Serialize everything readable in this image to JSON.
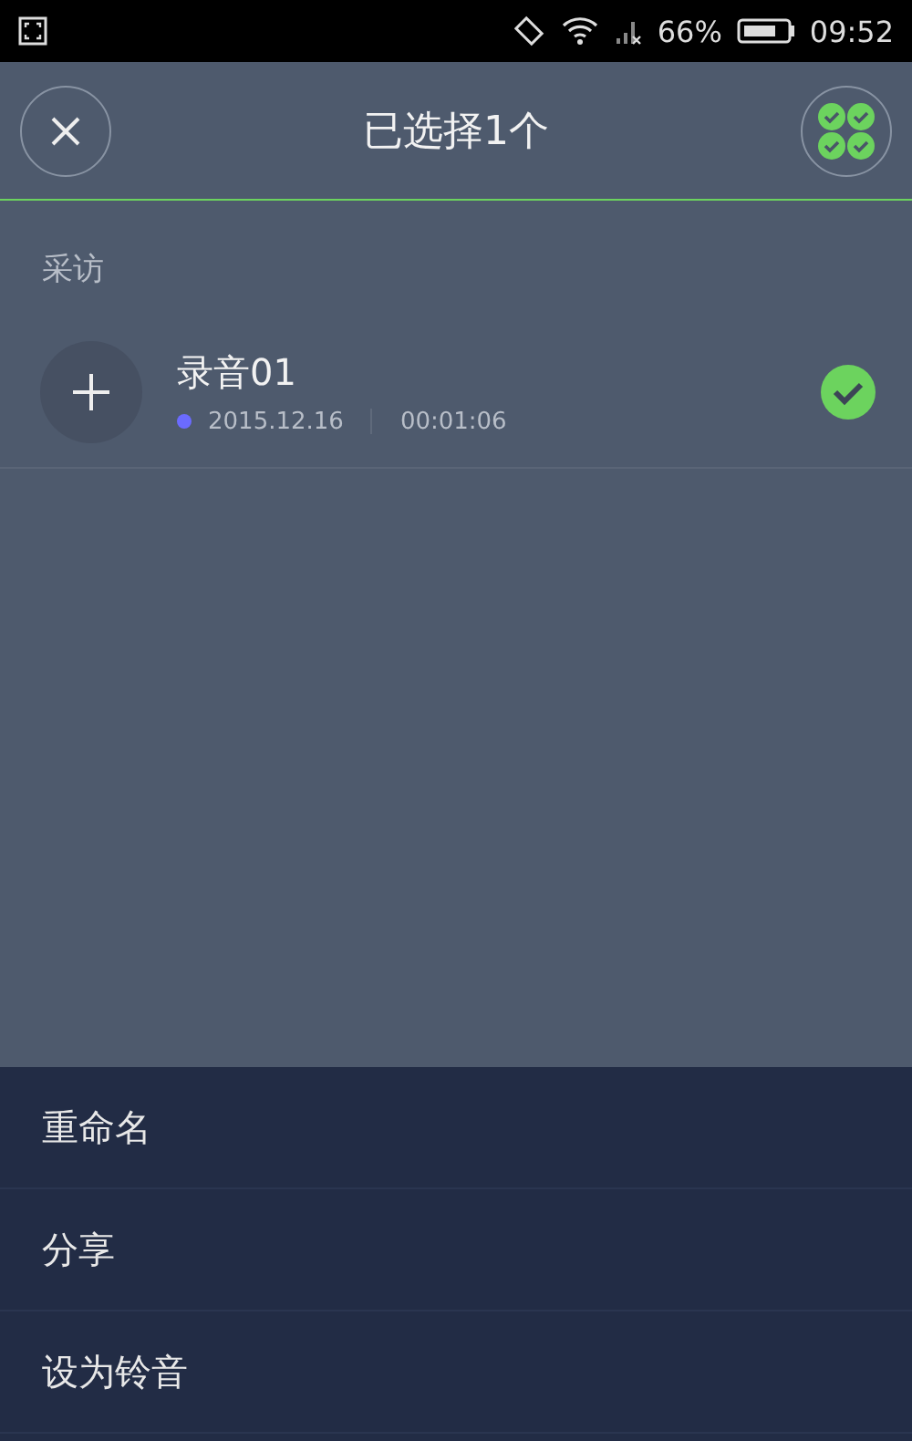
{
  "status_bar": {
    "battery_text": "66%",
    "time": "09:52"
  },
  "header": {
    "title": "已选择1个"
  },
  "section": {
    "title": "采访"
  },
  "recordings": [
    {
      "name": "录音01",
      "date": "2015.12.16",
      "duration": "00:01:06",
      "color": "#6b6bff",
      "selected": true
    }
  ],
  "menu": [
    "重命名",
    "分享",
    "设为铃音"
  ]
}
